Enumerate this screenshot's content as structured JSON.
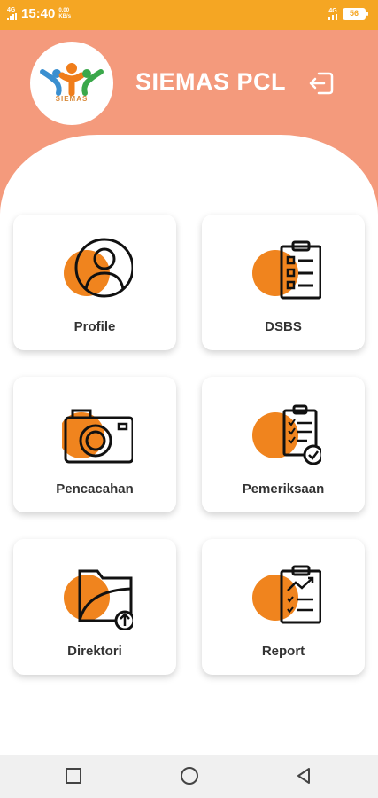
{
  "status_bar": {
    "network": "4G",
    "time": "15:40",
    "speed_value": "0.00",
    "speed_unit": "KB/s",
    "signal_label": "4G",
    "battery": "56"
  },
  "header": {
    "logo_text": "SIEMAS",
    "title": "SIEMAS PCL",
    "logout_icon": "logout-icon"
  },
  "menu": [
    {
      "label": "Profile",
      "icon": "profile-icon"
    },
    {
      "label": "DSBS",
      "icon": "checklist-icon"
    },
    {
      "label": "Pencacahan",
      "icon": "camera-icon"
    },
    {
      "label": "Pemeriksaan",
      "icon": "clipboard-check-icon"
    },
    {
      "label": "Direktori",
      "icon": "folder-upload-icon"
    },
    {
      "label": "Report",
      "icon": "report-icon"
    }
  ],
  "nav_bar": [
    "recent-apps-button",
    "home-button",
    "back-button"
  ],
  "colors": {
    "status_bar": "#f5a623",
    "header": "#f49a7c",
    "accent_circle": "#f0841e"
  }
}
